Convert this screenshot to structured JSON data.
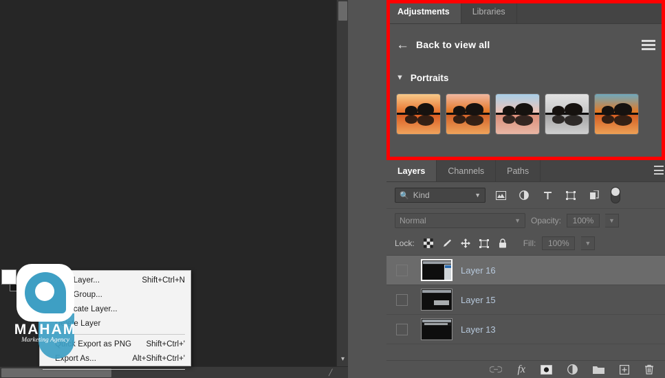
{
  "app": {
    "name": "Adobe Photoshop",
    "theme_bg": "#535353",
    "canvas_bg": "#262626"
  },
  "annotation": {
    "color": "#ff0000",
    "target": "adjustments-panel"
  },
  "adjustments_panel": {
    "tabs": [
      {
        "label": "Adjustments",
        "active": true
      },
      {
        "label": "Libraries",
        "active": false
      }
    ],
    "back_label": "Back to view all",
    "back_icon": "arrow-left-icon",
    "list_view_icon": "list-view-icon",
    "group": {
      "label": "Portraits",
      "expanded": true,
      "chevron_icon": "chevron-down-icon",
      "presets": [
        {
          "name": "preset-warm-sunset",
          "sky_top": "#f7c98a",
          "sky_bottom": "#e8702a",
          "water_top": "#d8551c",
          "water_bottom": "#f0a35c"
        },
        {
          "name": "preset-warm-sunset-2",
          "sky_top": "#f0b7a0",
          "sky_bottom": "#e4741f",
          "water_top": "#cf5b23",
          "water_bottom": "#efa35a"
        },
        {
          "name": "preset-cool-pastel",
          "sky_top": "#a9cfe8",
          "sky_bottom": "#f0c3b6",
          "water_top": "#d98a75",
          "water_bottom": "#e9b6a4"
        },
        {
          "name": "preset-black-and-white",
          "sky_top": "#e2e2e2",
          "sky_bottom": "#c8c8c8",
          "water_top": "#9f9f9f",
          "water_bottom": "#cfcfcf"
        },
        {
          "name": "preset-teal-sunset",
          "sky_top": "#6fa9bd",
          "sky_bottom": "#e8781f",
          "water_top": "#d1561c",
          "water_bottom": "#eda055"
        }
      ]
    }
  },
  "layers_panel": {
    "tabs": [
      {
        "label": "Layers",
        "active": true
      },
      {
        "label": "Channels",
        "active": false
      },
      {
        "label": "Paths",
        "active": false
      }
    ],
    "panel_menu_icon": "panel-menu-icon",
    "filter": {
      "search_icon": "search-icon",
      "kind_label": "Kind",
      "chevron_icon": "chevron-down-icon",
      "filter_icons": [
        {
          "name": "pixel-layer-filter-icon",
          "glyph": "image"
        },
        {
          "name": "adjustment-layer-filter-icon",
          "glyph": "half-circle"
        },
        {
          "name": "type-layer-filter-icon",
          "glyph": "T"
        },
        {
          "name": "shape-layer-filter-icon",
          "glyph": "shape"
        },
        {
          "name": "smart-object-filter-icon",
          "glyph": "smart-object"
        }
      ],
      "toggle_name": "filter-enable-toggle"
    },
    "blend": {
      "mode_label": "Normal",
      "opacity_label": "Opacity:",
      "opacity_value": "100%",
      "chevron_icon": "chevron-down-icon"
    },
    "lock": {
      "label": "Lock:",
      "buttons": [
        {
          "name": "lock-transparent-pixels-icon"
        },
        {
          "name": "lock-image-pixels-icon"
        },
        {
          "name": "lock-position-icon"
        },
        {
          "name": "lock-artboard-nesting-icon"
        },
        {
          "name": "lock-all-icon"
        }
      ],
      "fill_label": "Fill:",
      "fill_value": "100%"
    },
    "layers": [
      {
        "name": "Layer 16",
        "selected": true,
        "visible": false
      },
      {
        "name": "Layer 15",
        "selected": false,
        "visible": false
      },
      {
        "name": "Layer 13",
        "selected": false,
        "visible": false
      }
    ],
    "bottom_buttons": [
      {
        "name": "link-layers-button",
        "glyph": "link",
        "dim": true
      },
      {
        "name": "layer-styles-button",
        "glyph": "fx",
        "dim": false
      },
      {
        "name": "add-layer-mask-button",
        "glyph": "mask",
        "dim": false
      },
      {
        "name": "new-adjustment-layer-button",
        "glyph": "half-circle",
        "dim": false
      },
      {
        "name": "new-group-button",
        "glyph": "folder",
        "dim": false
      },
      {
        "name": "new-layer-button",
        "glyph": "plus-square",
        "dim": false
      },
      {
        "name": "delete-layer-button",
        "glyph": "trash",
        "dim": false
      }
    ]
  },
  "context_menu": {
    "items": [
      {
        "label": "New Layer...",
        "accel": "Shift+Ctrl+N",
        "separator_after": false
      },
      {
        "label": "New Group...",
        "accel": "",
        "separator_after": false
      },
      {
        "label": "Duplicate Layer...",
        "accel": "",
        "separator_after": false
      },
      {
        "label": "Delete Layer",
        "accel": "",
        "separator_after": true
      },
      {
        "label": "Quick Export as PNG",
        "accel": "Shift+Ctrl+'",
        "separator_after": false
      },
      {
        "label": "Export As...",
        "accel": "Alt+Shift+Ctrl+'",
        "separator_after": true
      }
    ]
  },
  "watermark": {
    "brand": "MAHAM",
    "tagline": "Marketing Agency",
    "accent": "#3e9fc4"
  },
  "toolbar": {
    "foreground_background_swatch": "foreground-background-color-swatch"
  },
  "scrollbars": {
    "vertical_name": "canvas-vertical-scrollbar",
    "horizontal_name": "canvas-horizontal-scrollbar",
    "chevron_icon": "chevron-down-icon"
  }
}
